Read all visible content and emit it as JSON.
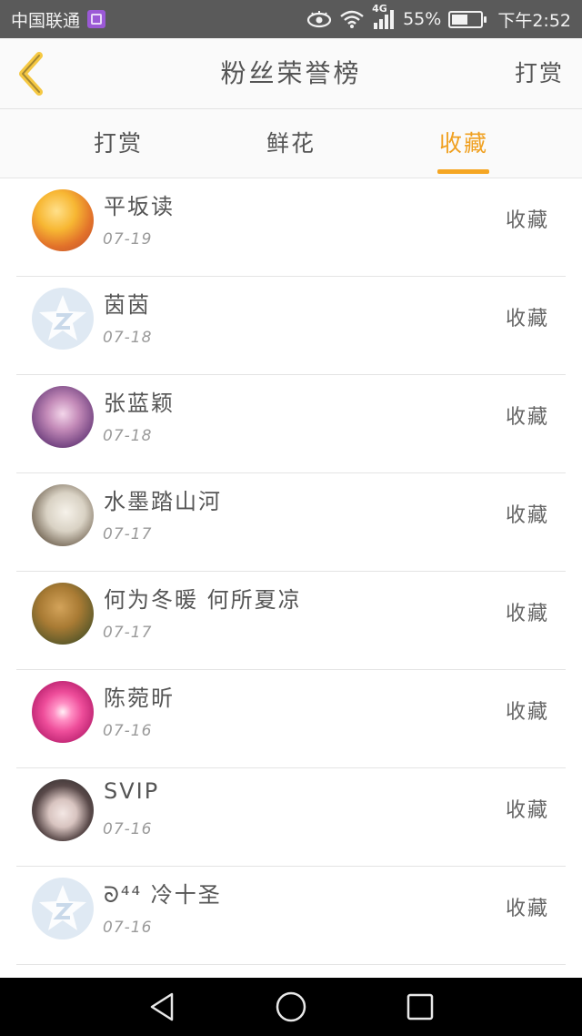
{
  "status_bar": {
    "carrier": "中国联通",
    "network": "4G",
    "battery_percent_text": "55%",
    "battery_level": 0.55,
    "time": "下午2:52",
    "icons": [
      "app-notification-icon",
      "eye-icon",
      "wifi-icon",
      "signal-icon",
      "battery-icon"
    ]
  },
  "header": {
    "back_icon": "chevron-left-icon",
    "title": "粉丝荣誉榜",
    "reward_label": "打赏"
  },
  "tabs": {
    "items": [
      "打赏",
      "鲜花",
      "收藏"
    ],
    "active_index": 2,
    "active_color": "#f0a020"
  },
  "list": {
    "items": [
      {
        "name": "平坂读",
        "date": "07-19",
        "action": "收藏",
        "avatar": "anime-girl-yellow"
      },
      {
        "name": "茵茵",
        "date": "07-18",
        "action": "收藏",
        "avatar": "default-avatar"
      },
      {
        "name": "张蓝颖",
        "date": "07-18",
        "action": "收藏",
        "avatar": "anime-girl-purple"
      },
      {
        "name": "水墨踏山河",
        "date": "07-17",
        "action": "收藏",
        "avatar": "ink-painting"
      },
      {
        "name": "何为冬暖 何所夏凉",
        "date": "07-17",
        "action": "收藏",
        "avatar": "lion"
      },
      {
        "name": "陈菀昕",
        "date": "07-16",
        "action": "收藏",
        "avatar": "pink-flower"
      },
      {
        "name": "SVIP",
        "date": "07-16",
        "action": "收藏",
        "avatar": "girl-photo"
      },
      {
        "name": "ᘐ⁴⁴ 冷十圣",
        "date": "07-16",
        "action": "收藏",
        "avatar": "default-avatar"
      }
    ]
  },
  "nav_bar": {
    "buttons": [
      "back-triangle-icon",
      "home-circle-icon",
      "recents-square-icon"
    ]
  }
}
